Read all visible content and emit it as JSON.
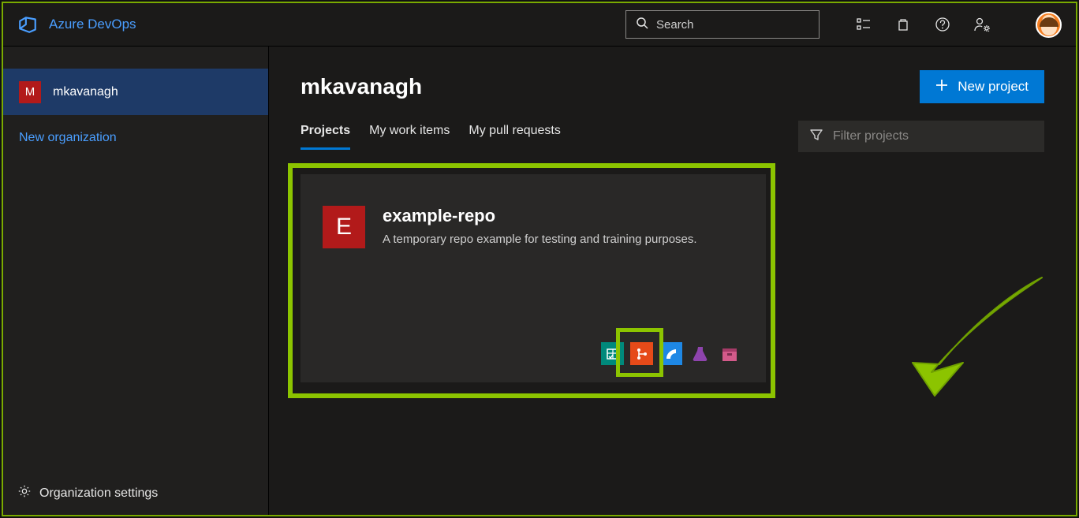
{
  "header": {
    "brand": "Azure DevOps",
    "search_placeholder": "Search"
  },
  "sidebar": {
    "org": {
      "initial": "M",
      "name": "mkavanagh"
    },
    "new_org_label": "New organization",
    "settings_label": "Organization settings"
  },
  "main": {
    "title": "mkavanagh",
    "new_project_label": "New project",
    "tabs": {
      "projects": "Projects",
      "work_items": "My work items",
      "pull_requests": "My pull requests"
    },
    "filter_placeholder": "Filter projects"
  },
  "project": {
    "initial": "E",
    "name": "example-repo",
    "description": "A temporary repo example for testing and training purposes."
  }
}
